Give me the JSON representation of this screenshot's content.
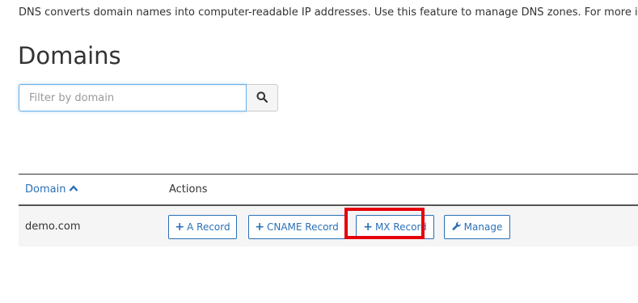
{
  "intro_text": "DNS converts domain names into computer-readable IP addresses. Use this feature to manage DNS zones. For more i",
  "title": "Domains",
  "search": {
    "placeholder": "Filter by domain",
    "value": "",
    "button_icon": "search-icon"
  },
  "table": {
    "columns": {
      "domain": "Domain",
      "actions": "Actions"
    },
    "sort_icon": "chevron-up-icon",
    "rows": [
      {
        "domain": "demo.com",
        "buttons": {
          "a_record": "A Record",
          "cname_record": "CNAME Record",
          "mx_record": "MX Record",
          "manage": "Manage"
        }
      }
    ]
  },
  "colors": {
    "link": "#2a70b8",
    "highlight": "#e6000a",
    "row_bg": "#f5f5f5"
  }
}
